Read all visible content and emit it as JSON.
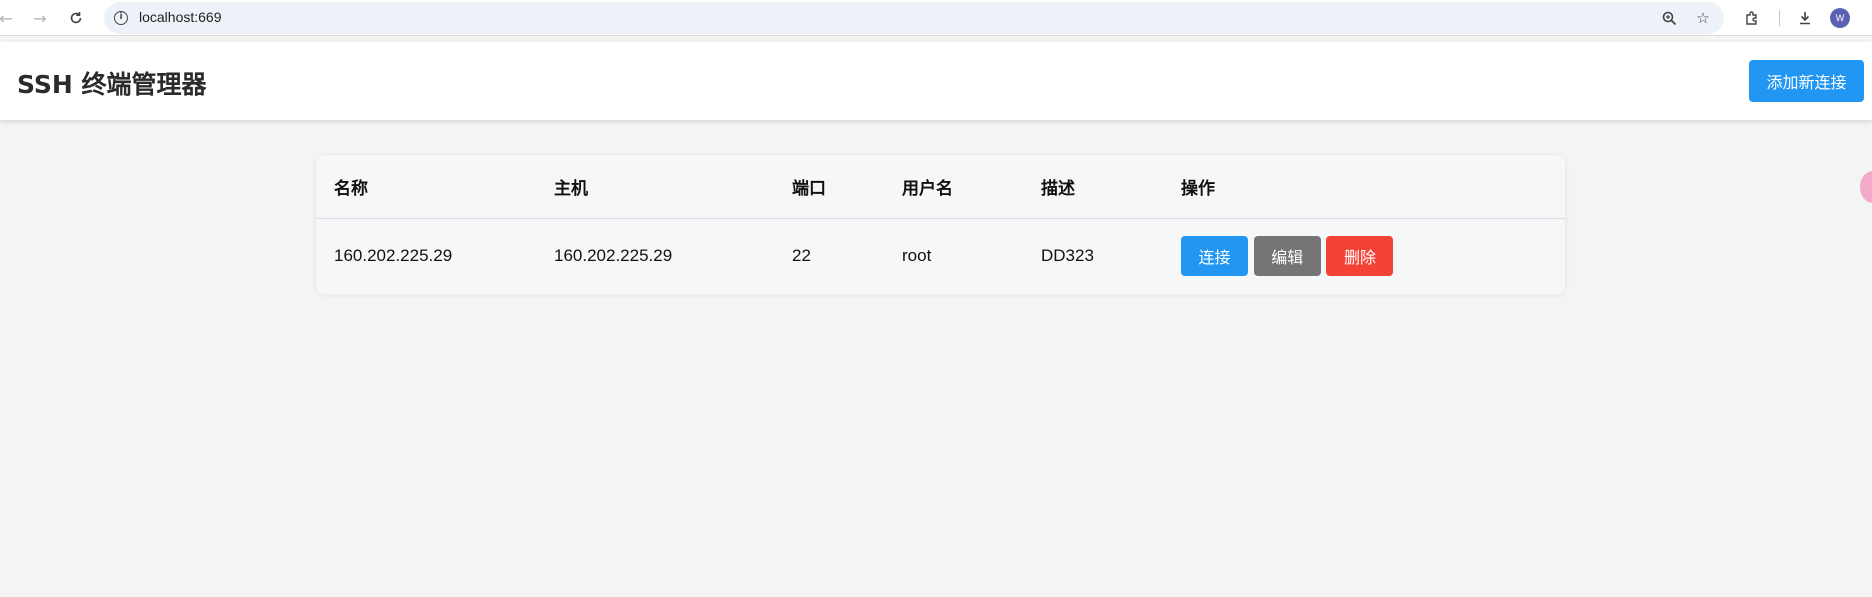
{
  "browser": {
    "url": "localhost:669",
    "avatar_letter": "W"
  },
  "app": {
    "title": "SSH 终端管理器",
    "add_button": "添加新连接"
  },
  "table": {
    "columns": [
      "名称",
      "主机",
      "端口",
      "用户名",
      "描述",
      "操作"
    ],
    "rows": [
      {
        "name": "160.202.225.29",
        "host": "160.202.225.29",
        "port": "22",
        "username": "root",
        "description": "DD323",
        "actions": {
          "connect": "连接",
          "edit": "编辑",
          "delete": "删除"
        }
      }
    ]
  },
  "colors": {
    "primary": "#2196f3",
    "edit": "#757575",
    "danger": "#f44336",
    "page_background": "#f4f4f4"
  }
}
